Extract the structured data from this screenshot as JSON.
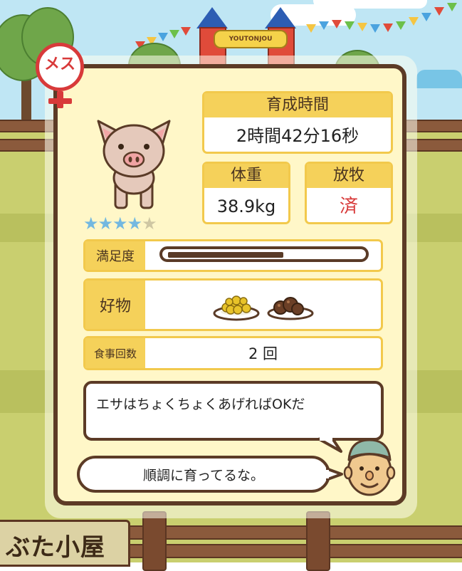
{
  "location_sign": "ぶた小屋",
  "gate_sign": "YOUTONJOU",
  "pig": {
    "gender_label": "メス",
    "rating": {
      "value": 4,
      "max": 5
    },
    "growth_time": {
      "label": "育成時間",
      "value": "2時間42分16秒"
    },
    "weight": {
      "label": "体重",
      "value": "38.9kg"
    },
    "grazing": {
      "label": "放牧",
      "value": "済"
    },
    "satisfaction": {
      "label": "満足度",
      "level": 0.6
    },
    "favorite_food": {
      "label": "好物",
      "items": [
        "corn-dish-icon",
        "chestnut-dish-icon"
      ]
    },
    "meal_count": {
      "label": "食事回数",
      "value": "2 回"
    }
  },
  "messages": {
    "tip": "エサはちょくちょくあげればOKだ",
    "comment": "順調に育ってるな。"
  },
  "colors": {
    "panel_bg": "#fff7c8",
    "panel_border": "#5c3b26",
    "label_bg": "#f5d15a",
    "female_red": "#d83a3a",
    "star_on": "#73b8e0",
    "grazing_value": "#d83a3a"
  }
}
